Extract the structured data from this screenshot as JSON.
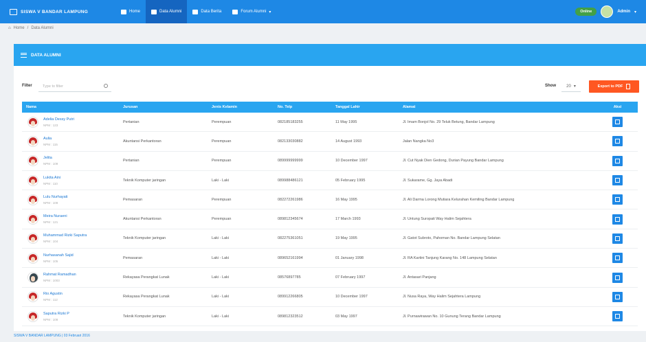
{
  "brand": {
    "title": "SISWA V BANDAR LAMPUNG",
    "logo_icon": "graduation-cap-icon"
  },
  "nav": [
    {
      "label": "Home",
      "icon": "home-icon",
      "active": false
    },
    {
      "label": "Data Alumni",
      "icon": "table-icon",
      "active": true
    },
    {
      "label": "Data Berita",
      "icon": "news-icon",
      "active": false
    },
    {
      "label": "Forum Alumni",
      "icon": "forum-icon",
      "active": false
    }
  ],
  "user": {
    "status": "Online",
    "name": "Admin"
  },
  "breadcrumb": {
    "home": "Home",
    "current": "Data Alumni"
  },
  "panel": {
    "title": "DATA ALUMNI"
  },
  "tools": {
    "filter_label": "Filter",
    "filter_placeholder": "Type to filter",
    "show_label": "Show",
    "show_value": "20",
    "export_label": "Export to PDF"
  },
  "table": {
    "headers": {
      "nama": "Nama",
      "jurusan": "Jurusan",
      "jk": "Jenis Kelamin",
      "hp": "No. Telp",
      "tgl": "Tanggal Lahir",
      "alamat": "Alamat",
      "aksi": "Aksi"
    },
    "rows": [
      {
        "nama": "Adelia Dessy Putri",
        "nim": "NPM : 123",
        "jurusan": "Pertanian",
        "jk": "Perempuan",
        "hp": "082185183255",
        "tgl": "11 May 1995",
        "alamat": "Jl. Imam Bonjol No. 29 Teluk Betung, Bandar Lampung"
      },
      {
        "nama": "Aulia",
        "nim": "NPM : 115",
        "jurusan": "Akuntansi Perkantoran",
        "jk": "Perempuan",
        "hp": "082133030882",
        "tgl": "14 August 1993",
        "alamat": "Jalan Nangka No3"
      },
      {
        "nama": "Jelita",
        "nim": "NPM : 109",
        "jurusan": "Pertanian",
        "jk": "Perempuan",
        "hp": "089999999999",
        "tgl": "10 December 1997",
        "alamat": "Jl. Cut Nyak Dien Gedong, Durian Payung Bandar Lampung"
      },
      {
        "nama": "Lukita Aini",
        "nim": "NPM : 110",
        "jurusan": "Teknik Komputer jaringan",
        "jk": "Laki - Laki",
        "hp": "089988486121",
        "tgl": "05 February 1995",
        "alamat": "Jl. Sukarame, Gg. Jaya Abadi"
      },
      {
        "nama": "Lulu Nurhayati",
        "nim": "NPM : 109",
        "jurusan": "Pemasaran",
        "jk": "Perempuan",
        "hp": "082272261986",
        "tgl": "16 May 1995",
        "alamat": "Jl. Ali Darma Lorong Mutiara Kelurahan Kemiling Bandar Lampung"
      },
      {
        "nama": "Meira Nuraeni",
        "nim": "NPM : 121",
        "jurusan": "Akuntansi Perkantoran",
        "jk": "Perempuan",
        "hp": "089812345674",
        "tgl": "17 March 1993",
        "alamat": "Jl. Untung Suropati Way Halim Sejahtera"
      },
      {
        "nama": "Muhammad Rizki Saputra",
        "nim": "NPM : 104",
        "jurusan": "Teknik Komputer jaringan",
        "jk": "Laki - Laki",
        "hp": "082275361051",
        "tgl": "19 May 1995",
        "alamat": "Jl. Gatot Subroto, Pahoman No. Bandar Lampung Selatan"
      },
      {
        "nama": "Nurhasanah Sajid",
        "nim": "NPM : 105",
        "jurusan": "Pemasaran",
        "jk": "Laki - Laki",
        "hp": "089652161994",
        "tgl": "01 January 1998",
        "alamat": "Jl. RA Kartini Tanjung Karang No. 148 Lampung Selatan"
      },
      {
        "nama": "Rahmat Ramadhan",
        "nim": "NPM : 1003",
        "jurusan": "Rekayasa Perangkat Lunak",
        "jk": "Laki - Laki",
        "hp": "08576897785",
        "tgl": "07 February 1997",
        "alamat": "Jl. Antasari Panjang"
      },
      {
        "nama": "Rio Agustin",
        "nim": "NPM : 112",
        "jurusan": "Rekayasa Perangkat Lunak",
        "jk": "Laki - Laki",
        "hp": "089912266805",
        "tgl": "10 December 1997",
        "alamat": "Jl. Nusa Raya, Way Halim Sejahtera Lampung"
      },
      {
        "nama": "Saputra Rizki P",
        "nim": "NPM : 108",
        "jurusan": "Teknik Komputer jaringan",
        "jk": "Laki - Laki",
        "hp": "089812323512",
        "tgl": "03 May 1997",
        "alamat": "Jl. Purnawirawan No. 10 Gunung Terang Bandar Lampung"
      }
    ]
  },
  "footer": {
    "text": "SISWA V BANDAR LAMPUNG | 03 Februari 2016"
  }
}
